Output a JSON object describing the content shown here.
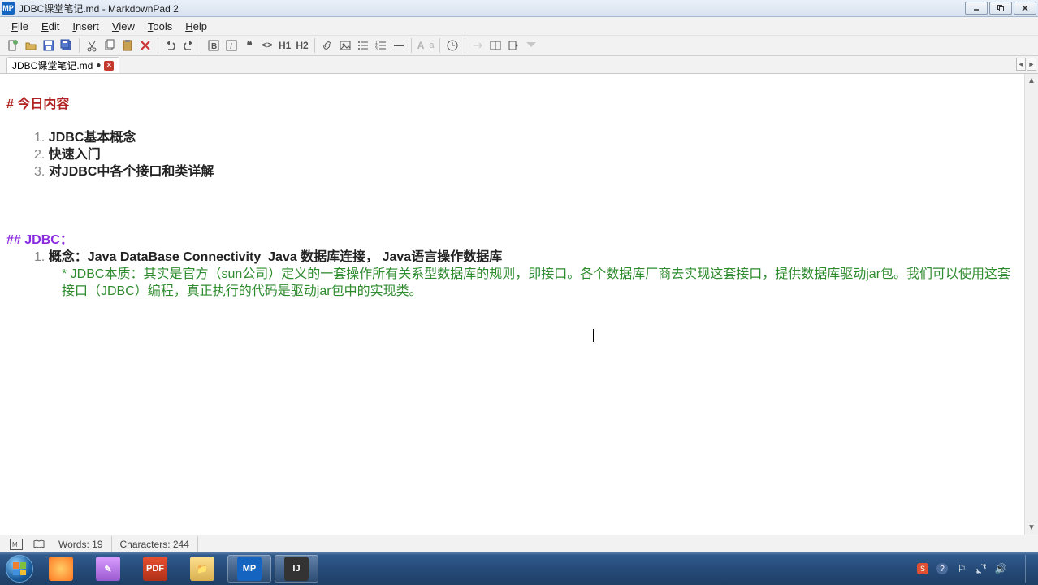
{
  "title": {
    "file": "JDBC课堂笔记.md",
    "app": "MarkdownPad 2"
  },
  "menu": {
    "file": "File",
    "edit": "Edit",
    "insert": "Insert",
    "view": "View",
    "tools": "Tools",
    "help": "Help"
  },
  "toolbar": {
    "h1": "H1",
    "h2": "H2",
    "A": "A",
    "a": "a"
  },
  "tab": {
    "name": "JDBC课堂笔记.md"
  },
  "content": {
    "h1": "今日内容",
    "ol1": {
      "n1": "1.",
      "t1": "JDBC基本概念",
      "n2": "2.",
      "t2": "快速入门",
      "n3": "3.",
      "t3": "对JDBC中各个接口和类详解"
    },
    "h2": "JDBC：",
    "ol2": {
      "n1": "1.",
      "t1": "概念：Java DataBase Connectivity  Java 数据库连接， Java语言操作数据库"
    },
    "comment": "* JDBC本质：其实是官方（sun公司）定义的一套操作所有关系型数据库的规则，即接口。各个数据库厂商去实现这套接口，提供数据库驱动jar包。我们可以使用这套接口（JDBC）编程，真正执行的代码是驱动jar包中的实现类。"
  },
  "status": {
    "words_lbl": "Words:",
    "words": "19",
    "chars_lbl": "Characters:",
    "chars": "244"
  },
  "tray": {
    "time": ""
  }
}
